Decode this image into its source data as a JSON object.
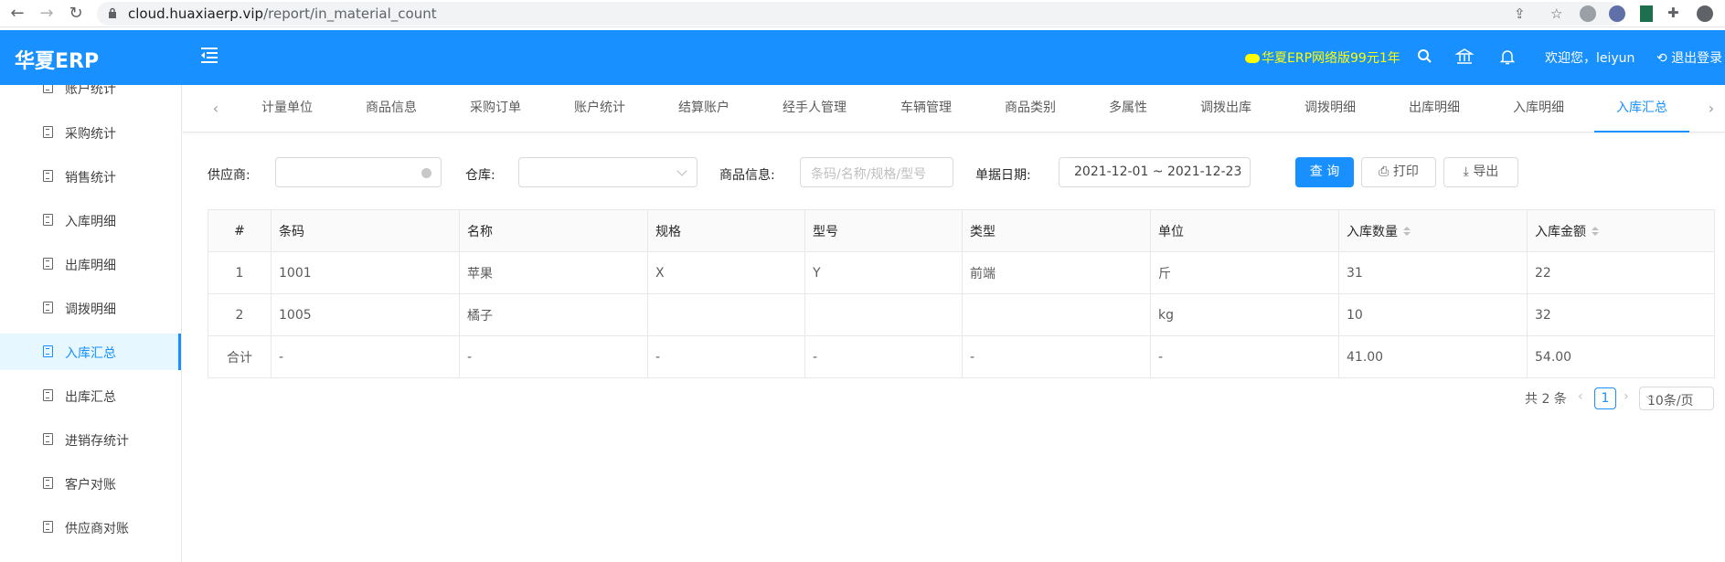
{
  "browser": {
    "url_host": "cloud.huaxiaerp.vip",
    "url_path": "/report/in_material_count"
  },
  "header": {
    "logo": "华夏ERP",
    "promo": "华夏ERP网络版99元1年",
    "welcome": "欢迎您，leiyun",
    "logout": "退出登录"
  },
  "sidebar": {
    "items": [
      {
        "label": "账户统计"
      },
      {
        "label": "采购统计"
      },
      {
        "label": "销售统计"
      },
      {
        "label": "入库明细"
      },
      {
        "label": "出库明细"
      },
      {
        "label": "调拨明细"
      },
      {
        "label": "入库汇总",
        "active": true
      },
      {
        "label": "出库汇总"
      },
      {
        "label": "进销存统计"
      },
      {
        "label": "客户对账"
      },
      {
        "label": "供应商对账"
      }
    ]
  },
  "tabs": [
    {
      "label": "计量单位"
    },
    {
      "label": "商品信息"
    },
    {
      "label": "采购订单"
    },
    {
      "label": "账户统计"
    },
    {
      "label": "结算账户"
    },
    {
      "label": "经手人管理"
    },
    {
      "label": "车辆管理"
    },
    {
      "label": "商品类别"
    },
    {
      "label": "多属性"
    },
    {
      "label": "调拨出库"
    },
    {
      "label": "调拨明细"
    },
    {
      "label": "出库明细"
    },
    {
      "label": "入库明细"
    },
    {
      "label": "入库汇总",
      "active": true
    }
  ],
  "filters": {
    "supplier_label": "供应商:",
    "supplier_value": "",
    "warehouse_label": "仓库:",
    "warehouse_value": "",
    "product_label": "商品信息:",
    "product_placeholder": "条码/名称/规格/型号",
    "date_label": "单据日期:",
    "date_value": "2021-12-01 ~ 2021-12-23",
    "query_button": "查 询",
    "print_button": "打印",
    "export_button": "导出"
  },
  "table": {
    "columns": [
      "#",
      "条码",
      "名称",
      "规格",
      "型号",
      "类型",
      "单位",
      "入库数量",
      "入库金额"
    ],
    "rows": [
      [
        "1",
        "1001",
        "苹果",
        "X",
        "Y",
        "前端",
        "斤",
        "31",
        "22"
      ],
      [
        "2",
        "1005",
        "橘子",
        "",
        "",
        "",
        "kg",
        "10",
        "32"
      ],
      [
        "合计",
        "-",
        "-",
        "-",
        "-",
        "-",
        "-",
        "41.00",
        "54.00"
      ]
    ]
  },
  "pagination": {
    "total": "共 2 条",
    "current_page": "1",
    "page_size": "10条/页"
  },
  "colors": {
    "primary": "#1890ff",
    "promo": "#ffff00"
  }
}
